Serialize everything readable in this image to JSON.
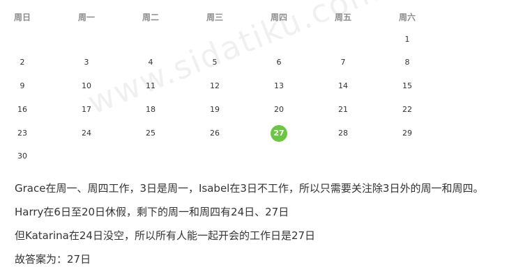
{
  "calendar": {
    "weekdays": [
      "周日",
      "周一",
      "周二",
      "周三",
      "周四",
      "周五",
      "周六"
    ],
    "days": [
      [
        "",
        "",
        "",
        "",
        "",
        "",
        "1"
      ],
      [
        "2",
        "3",
        "4",
        "5",
        "6",
        "7",
        "8"
      ],
      [
        "9",
        "10",
        "11",
        "12",
        "13",
        "14",
        "15"
      ],
      [
        "16",
        "17",
        "18",
        "19",
        "20",
        "21",
        "22"
      ],
      [
        "23",
        "24",
        "25",
        "26",
        "27",
        "28",
        "29"
      ],
      [
        "30",
        "",
        "",
        "",
        "",
        "",
        ""
      ]
    ],
    "selected_day": "27",
    "selected_color": "#6cc644"
  },
  "watermark": "www.sidatiku.com",
  "explanation": [
    "Grace在周一、周四工作，3日是周一，Isabel在3日不工作，所以只需要关注除3日外的周一和周四。",
    "Harry在6日至20日休假，剩下的周一和周四有24日、27日",
    "但Katarina在24日没空，所以所有人能一起开会的工作日是27日",
    "故答案为：27日"
  ]
}
